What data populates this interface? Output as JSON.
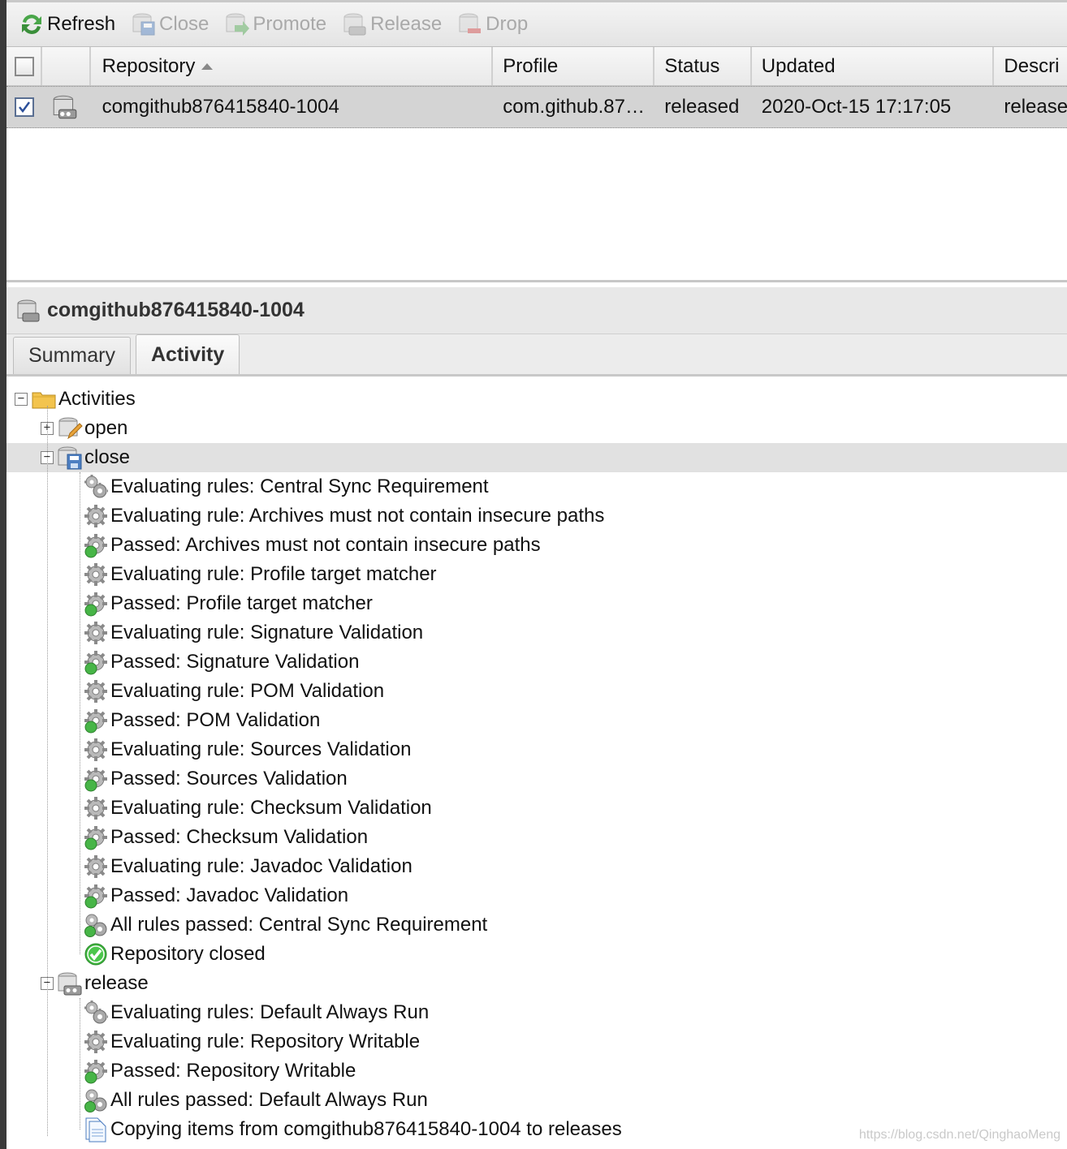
{
  "toolbar": {
    "refresh": "Refresh",
    "close": "Close",
    "promote": "Promote",
    "release": "Release",
    "drop": "Drop"
  },
  "grid": {
    "headers": {
      "repository": "Repository",
      "profile": "Profile",
      "status": "Status",
      "updated": "Updated",
      "description": "Descri"
    },
    "row": {
      "selected": true,
      "repository": "comgithub876415840-1004",
      "profile": "com.github.87…",
      "status": "released",
      "updated": "2020-Oct-15 17:17:05",
      "description": "release"
    }
  },
  "detail": {
    "title": "comgithub876415840-1004",
    "tabs": [
      "Summary",
      "Activity"
    ],
    "active_tab": "Activity"
  },
  "tree": {
    "root": "Activities",
    "groups": [
      {
        "label": "open",
        "expanded": false,
        "icon": "open-edit-icon",
        "items": []
      },
      {
        "label": "close",
        "expanded": true,
        "selected": true,
        "icon": "close-save-icon",
        "items": [
          {
            "label": "Evaluating rules: Central Sync Requirement",
            "icon": "gears-icon"
          },
          {
            "label": "Evaluating rule: Archives must not contain insecure paths",
            "icon": "gear-icon"
          },
          {
            "label": "Passed: Archives must not contain insecure paths",
            "icon": "gear-passed-icon"
          },
          {
            "label": "Evaluating rule: Profile target matcher",
            "icon": "gear-icon"
          },
          {
            "label": "Passed: Profile target matcher",
            "icon": "gear-passed-icon"
          },
          {
            "label": "Evaluating rule: Signature Validation",
            "icon": "gear-icon"
          },
          {
            "label": "Passed: Signature Validation",
            "icon": "gear-passed-icon"
          },
          {
            "label": "Evaluating rule: POM Validation",
            "icon": "gear-icon"
          },
          {
            "label": "Passed: POM Validation",
            "icon": "gear-passed-icon"
          },
          {
            "label": "Evaluating rule: Sources Validation",
            "icon": "gear-icon"
          },
          {
            "label": "Passed: Sources Validation",
            "icon": "gear-passed-icon"
          },
          {
            "label": "Evaluating rule: Checksum Validation",
            "icon": "gear-icon"
          },
          {
            "label": "Passed: Checksum Validation",
            "icon": "gear-passed-icon"
          },
          {
            "label": "Evaluating rule: Javadoc Validation",
            "icon": "gear-icon"
          },
          {
            "label": "Passed: Javadoc Validation",
            "icon": "gear-passed-icon"
          },
          {
            "label": "All rules passed: Central Sync Requirement",
            "icon": "gears-passed-icon"
          },
          {
            "label": "Repository closed",
            "icon": "check-circle-icon"
          }
        ]
      },
      {
        "label": "release",
        "expanded": true,
        "icon": "release-repo-icon",
        "items": [
          {
            "label": "Evaluating rules: Default Always Run",
            "icon": "gears-icon"
          },
          {
            "label": "Evaluating rule: Repository Writable",
            "icon": "gear-icon"
          },
          {
            "label": "Passed: Repository Writable",
            "icon": "gear-passed-icon"
          },
          {
            "label": "All rules passed: Default Always Run",
            "icon": "gears-passed-icon"
          },
          {
            "label": "Copying items from comgithub876415840-1004 to releases",
            "icon": "document-copy-icon"
          }
        ]
      }
    ]
  },
  "watermark": "https://blog.csdn.net/QinghaoMeng"
}
